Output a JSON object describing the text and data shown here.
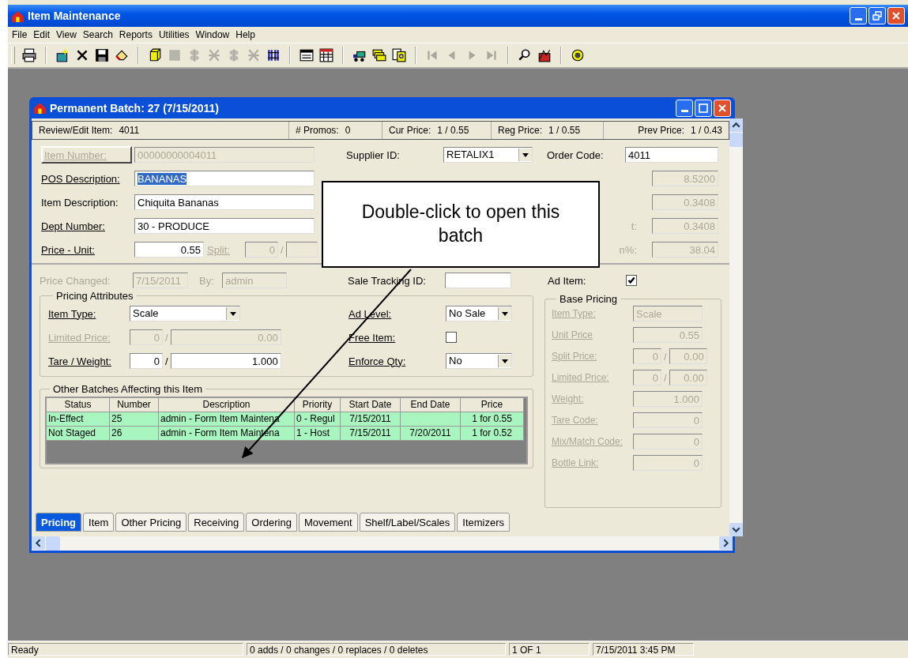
{
  "app": {
    "title": "Item Maintenance"
  },
  "menu": [
    "File",
    "Edit",
    "View",
    "Search",
    "Reports",
    "Utilities",
    "Window",
    "Help"
  ],
  "toolbar": [
    [
      {
        "kind": "print",
        "disabled": false
      }
    ],
    [
      {
        "kind": "new",
        "disabled": false
      },
      {
        "kind": "delete",
        "disabled": false
      },
      {
        "kind": "save",
        "disabled": false
      },
      {
        "kind": "eraser",
        "disabled": false
      }
    ],
    [
      {
        "kind": "box",
        "disabled": false
      },
      {
        "kind": "square",
        "disabled": true
      },
      {
        "kind": "dollar",
        "disabled": true
      },
      {
        "kind": "strike",
        "disabled": true
      },
      {
        "kind": "dollar",
        "disabled": true
      },
      {
        "kind": "strike",
        "disabled": true
      },
      {
        "kind": "columns",
        "disabled": false
      }
    ],
    [
      {
        "kind": "form",
        "disabled": false
      },
      {
        "kind": "grid",
        "disabled": false
      }
    ],
    [
      {
        "kind": "truck",
        "disabled": false
      },
      {
        "kind": "stack",
        "disabled": false
      },
      {
        "kind": "docq",
        "disabled": false
      }
    ],
    [
      {
        "kind": "first",
        "disabled": true
      },
      {
        "kind": "prev",
        "disabled": true
      },
      {
        "kind": "next",
        "disabled": true
      },
      {
        "kind": "last",
        "disabled": true
      }
    ],
    [
      {
        "kind": "search",
        "disabled": false
      },
      {
        "kind": "chart",
        "disabled": false
      }
    ],
    [
      {
        "kind": "coin",
        "disabled": false
      }
    ]
  ],
  "batch_window": {
    "title": "Permanent Batch: 27  (7/15/2011)",
    "header": [
      {
        "label": "Review/Edit Item:",
        "value": "4011"
      },
      {
        "label": "# Promos:",
        "value": "0"
      },
      {
        "label": "Cur Price:",
        "value": "1 / 0.55"
      },
      {
        "label": "Reg Price:",
        "value": "1 / 0.55"
      },
      {
        "label": "Prev Price:",
        "value": "1 / 0.43"
      }
    ],
    "item_rows": [
      {
        "left": [
          {
            "kind": "button_label",
            "label": "Item Number:",
            "value": "00000000004011",
            "disabled": true
          }
        ],
        "middle": [
          {
            "kind": "select",
            "label": "Supplier ID:",
            "value": "RETALIX1"
          }
        ],
        "right": [
          {
            "kind": "text",
            "label": "Order Code:",
            "value": "4011"
          }
        ]
      },
      {
        "left": [
          {
            "kind": "text",
            "label": "POS Description:",
            "underlined": true,
            "value": "BANANAS",
            "highlighted": true
          }
        ],
        "right": [
          {
            "kind": "number",
            "value": "8.5200",
            "disabled": true
          }
        ]
      },
      {
        "left": [
          {
            "kind": "text",
            "label": "Item Description:",
            "underlined": false,
            "value": "Chiquita Bananas"
          }
        ],
        "right": [
          {
            "kind": "number",
            "value": "0.3408",
            "disabled": true
          }
        ]
      },
      {
        "left": [
          {
            "kind": "text",
            "label": "Dept Number:",
            "underlined": true,
            "value": "30 - PRODUCE"
          }
        ],
        "right": [
          {
            "kind": "number",
            "label": "t:",
            "value": "0.3408",
            "disabled": true
          }
        ]
      },
      {
        "left": [
          {
            "kind": "number",
            "label": "Price - Unit:",
            "underlined": true,
            "value": "0.55"
          },
          {
            "kind": "pair",
            "label": "Split:",
            "underlined": true,
            "disabled": true,
            "value": "0",
            "separator": "/"
          }
        ],
        "right": [
          {
            "kind": "number",
            "label": "n%:",
            "value": "38.04",
            "disabled": true
          }
        ]
      }
    ],
    "price_changed": [
      {
        "kind": "text",
        "label": "Price Changed:",
        "value": "7/15/2011",
        "disabled": true
      },
      {
        "kind": "text",
        "label": "By:",
        "value": "admin",
        "disabled": true
      }
    ],
    "sale_tracking": {
      "kind": "text",
      "label": "Sale Tracking ID:"
    },
    "ad_item": {
      "kind": "check",
      "label": "Ad Item:",
      "checked": true
    },
    "pricing_attributes": {
      "title": "Pricing Attributes",
      "rows": [
        {
          "left": {
            "kind": "select",
            "label": "Item Type:",
            "underlined": true,
            "value": "Scale"
          },
          "right": {
            "kind": "select",
            "label": "Ad Level:",
            "underlined": true,
            "value": "No Sale"
          }
        },
        {
          "left": {
            "kind": "pair",
            "label": "Limited Price:",
            "underlined": true,
            "disabled": true,
            "value": "0",
            "separator": "/",
            "value2": "0.00"
          },
          "right": {
            "kind": "check",
            "label": "Free Item:",
            "underlined": true,
            "checked": false
          }
        },
        {
          "left": {
            "kind": "pair",
            "label": "Tare / Weight:",
            "underlined": true,
            "value": "0",
            "separator": "/",
            "value2": "1.000"
          },
          "right": {
            "kind": "select",
            "label": "Enforce Qty:",
            "underlined": true,
            "value": "No"
          }
        }
      ]
    },
    "other_batches": {
      "title": "Other Batches Affecting this Item",
      "columns": [
        "Status",
        "Number",
        "Description",
        "Priority",
        "Start Date",
        "End Date",
        "Price"
      ],
      "rows": [
        [
          "In-Effect",
          "25",
          "admin - Form Item Maintena",
          "0 - Regul",
          "7/15/2011",
          "",
          "1 for 0.55"
        ],
        [
          "Not Staged",
          "26",
          "admin - Form Item Maintena",
          "1 - Host",
          "7/15/2011",
          "7/20/2011",
          "1 for 0.52"
        ]
      ]
    },
    "base_pricing": {
      "title": "Base Pricing",
      "rows": [
        {
          "kind": "text",
          "label": "Item Type:",
          "underlined": true,
          "disabled": true,
          "value": "Scale"
        },
        {
          "kind": "number",
          "label": "Unit Price",
          "underlined": true,
          "disabled": true,
          "value": "0.55"
        },
        {
          "kind": "pair",
          "label": "Split Price:",
          "underlined": true,
          "disabled": true,
          "value": "0",
          "separator": "/",
          "value2": "0.00"
        },
        {
          "kind": "pair",
          "label": "Limited Price:",
          "underlined": true,
          "disabled": true,
          "value": "0",
          "separator": "/",
          "value2": "0.00"
        },
        {
          "kind": "number",
          "label": "Weight:",
          "underlined": true,
          "disabled": true,
          "value": "1.000"
        },
        {
          "kind": "number",
          "label": "Tare Code:",
          "underlined": true,
          "disabled": true,
          "value": "0"
        },
        {
          "kind": "number",
          "label": "Mix/Match Code:",
          "underlined": true,
          "disabled": true,
          "value": "0"
        },
        {
          "kind": "number",
          "label": "Bottle Link:",
          "underlined": true,
          "disabled": true,
          "value": "0"
        }
      ]
    },
    "tabs": [
      {
        "label": "Pricing",
        "selected": true
      },
      {
        "label": "Item",
        "selected": false
      },
      {
        "label": "Other Pricing",
        "selected": false
      },
      {
        "label": "Receiving",
        "selected": false
      },
      {
        "label": "Ordering",
        "selected": false
      },
      {
        "label": "Movement",
        "selected": false
      },
      {
        "label": "Shelf/Label/Scales",
        "selected": false
      },
      {
        "label": "Itemizers",
        "selected": false
      }
    ]
  },
  "callout": {
    "text": "Double-click to open this batch"
  },
  "status_bar": [
    "Ready",
    "0 adds / 0 changes / 0 replaces / 0 deletes",
    "1 OF 1",
    "7/15/2011 3:45 PM"
  ]
}
